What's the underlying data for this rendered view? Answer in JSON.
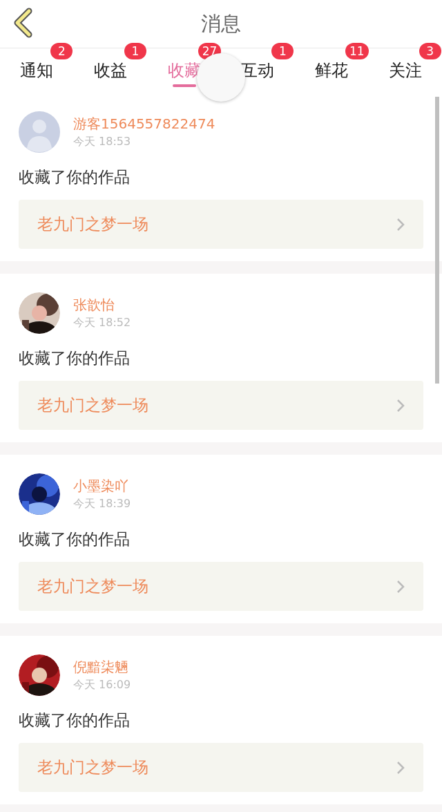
{
  "header": {
    "title": "消息"
  },
  "tabs": [
    {
      "label": "通知",
      "badge": "2",
      "selected": false
    },
    {
      "label": "收益",
      "badge": "1",
      "selected": false
    },
    {
      "label": "收藏",
      "badge": "27",
      "selected": true
    },
    {
      "label": "互动",
      "badge": "1",
      "selected": false
    },
    {
      "label": "鲜花",
      "badge": "11",
      "selected": false
    },
    {
      "label": "关注",
      "badge": "3",
      "selected": false
    }
  ],
  "messages": [
    {
      "avatar": {
        "kind": "default"
      },
      "user": "游客1564557822474",
      "time": "今天 18:53",
      "text": "收藏了你的作品",
      "work": "老九门之梦一场"
    },
    {
      "user": "张歆怡",
      "time": "今天 18:52",
      "text": "收藏了你的作品",
      "work": "老九门之梦一场"
    },
    {
      "user": "小墨染吖",
      "time": "今天 18:39",
      "text": "收藏了你的作品",
      "work": "老九门之梦一场"
    },
    {
      "user": "倪黯柒魎",
      "time": "今天 16:09",
      "text": "收藏了你的作品",
      "work": "老九门之梦一场"
    }
  ]
}
